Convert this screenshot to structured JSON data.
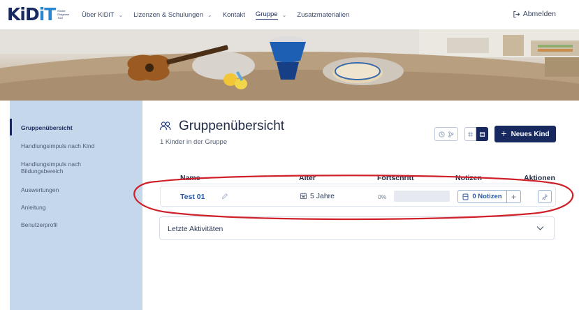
{
  "header": {
    "logo_text": "KiDiT",
    "logo_tagline": "Kinder Diagnose Tool",
    "nav": [
      {
        "label": "Über KiDiT",
        "has_dropdown": true,
        "active": false
      },
      {
        "label": "Lizenzen & Schulungen",
        "has_dropdown": true,
        "active": false
      },
      {
        "label": "Kontakt",
        "has_dropdown": false,
        "active": false
      },
      {
        "label": "Gruppe",
        "has_dropdown": true,
        "active": true
      },
      {
        "label": "Zusatzmaterialien",
        "has_dropdown": false,
        "active": false
      }
    ],
    "logout_label": "Abmelden"
  },
  "sidebar": {
    "items": [
      {
        "label": "Gruppenübersicht",
        "active": true
      },
      {
        "label": "Handlungsimpuls nach Kind",
        "active": false
      },
      {
        "label": "Handlungsimpuls nach Bildungsbereich",
        "active": false
      },
      {
        "label": "Auswertungen",
        "active": false
      },
      {
        "label": "Anleitung",
        "active": false
      },
      {
        "label": "Benutzerprofil",
        "active": false
      }
    ]
  },
  "main": {
    "title": "Gruppenübersicht",
    "subtitle": "1 Kinder in der Gruppe",
    "new_child_button": "Neues Kind",
    "table": {
      "headers": [
        "Name",
        "Alter",
        "Fortschritt",
        "Notizen",
        "Aktionen"
      ],
      "rows": [
        {
          "name": "Test 01",
          "age": "5 Jahre",
          "progress_label": "0%",
          "progress_value": 0,
          "notes_label": "0 Notizen"
        }
      ]
    },
    "accordion_label": "Letzte Aktivitäten"
  },
  "colors": {
    "primary": "#17295e",
    "link": "#2657a8",
    "sidebar_bg": "#c5d7ea",
    "highlight": "#d0202a"
  }
}
